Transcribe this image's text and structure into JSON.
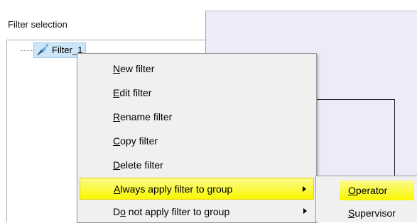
{
  "panel": {
    "title": "Filter selection",
    "tree_node": {
      "label": "Filter_1",
      "icon": "filter-icon"
    }
  },
  "context_menu": {
    "items": [
      {
        "label": "New filter",
        "underline_index": 0,
        "has_submenu": false,
        "highlighted": false
      },
      {
        "label": "Edit filter",
        "underline_index": 0,
        "has_submenu": false,
        "highlighted": false
      },
      {
        "label": "Rename filter",
        "underline_index": 0,
        "has_submenu": false,
        "highlighted": false
      },
      {
        "label": "Copy filter",
        "underline_index": 0,
        "has_submenu": false,
        "highlighted": false
      },
      {
        "label": "Delete filter",
        "underline_index": 0,
        "has_submenu": false,
        "highlighted": false
      },
      {
        "label": "Always apply filter to group",
        "underline_index": 0,
        "has_submenu": true,
        "highlighted": true
      },
      {
        "label": "Do not apply filter to group",
        "underline_index": 1,
        "has_submenu": true,
        "highlighted": false
      }
    ]
  },
  "submenu": {
    "items": [
      {
        "label": "Operator",
        "underline_index": 0,
        "highlighted": true
      },
      {
        "label": "Supervisor",
        "underline_index": 0,
        "highlighted": false
      }
    ]
  },
  "colors": {
    "highlight_yellow": "#f9f700",
    "menu_background": "#f0f0f0",
    "right_panel_background": "#ebebfa",
    "tree_node_selection": "#cde6f7"
  }
}
